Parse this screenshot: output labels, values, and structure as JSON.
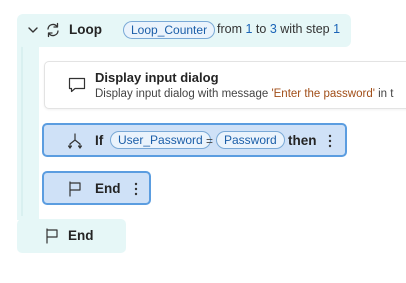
{
  "loop": {
    "keyword": "Loop",
    "variable": "Loop_Counter",
    "from_label": "from",
    "start": "1",
    "to_label": "to",
    "end": "3",
    "step_label": "with step",
    "step": "1",
    "end_keyword": "End"
  },
  "dialog_action": {
    "title": "Display input dialog",
    "desc_prefix": "Display input dialog with message",
    "message": "'Enter the password'",
    "desc_suffix": "in t"
  },
  "if_action": {
    "keyword": "If",
    "left_var": "User_Password",
    "operator": "=",
    "right_var": "Password",
    "then_keyword": "then"
  },
  "end_action": {
    "keyword": "End"
  },
  "icons": {
    "chevron": "chevron-down-icon",
    "loop": "loop-icon",
    "dialog": "message-icon",
    "if": "branch-icon",
    "end": "flag-icon",
    "more": "more-vertical-icon"
  },
  "colors": {
    "loop_bg": "#e6f7f7",
    "selected_bg": "#cfe1f7",
    "selected_border": "#5b9de0",
    "variable": "#1b5ea8",
    "number": "#1b64b7",
    "string": "#a14e18"
  }
}
